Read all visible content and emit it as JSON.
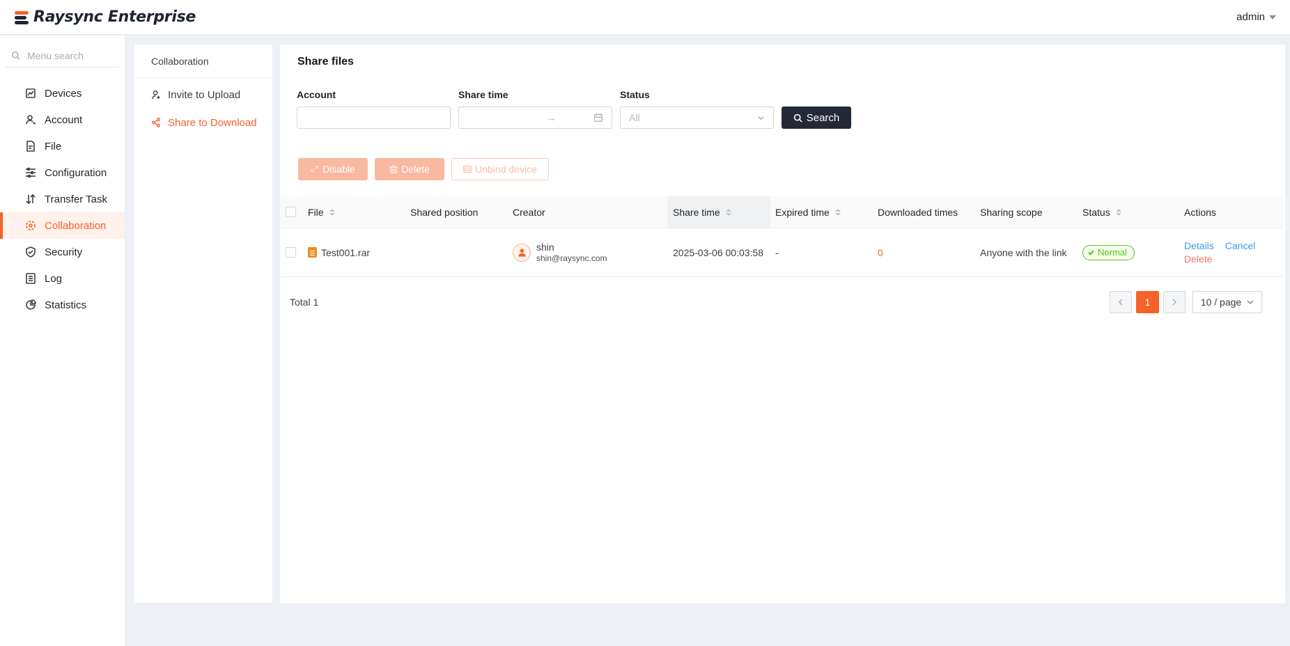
{
  "app": {
    "logo_text": "Raysync Enterprise",
    "user": "admin"
  },
  "sidebar": {
    "search_placeholder": "Menu search",
    "items": [
      {
        "label": "Devices",
        "icon": "devices-icon"
      },
      {
        "label": "Account",
        "icon": "user-icon"
      },
      {
        "label": "File",
        "icon": "file-icon"
      },
      {
        "label": "Configuration",
        "icon": "sliders-icon"
      },
      {
        "label": "Transfer Task",
        "icon": "transfer-icon"
      },
      {
        "label": "Collaboration",
        "icon": "collaboration-icon",
        "active": true
      },
      {
        "label": "Security",
        "icon": "shield-icon"
      },
      {
        "label": "Log",
        "icon": "log-icon"
      },
      {
        "label": "Statistics",
        "icon": "pie-chart-icon"
      }
    ]
  },
  "subnav": {
    "title": "Collaboration",
    "items": [
      {
        "label": "Invite to Upload",
        "icon": "invite-user-icon"
      },
      {
        "label": "Share to Download",
        "icon": "share-icon",
        "active": true
      }
    ]
  },
  "main": {
    "title": "Share files",
    "filters": {
      "account_label": "Account",
      "share_time_label": "Share time",
      "date_separator": "→",
      "status_label": "Status",
      "status_value": "All",
      "search_button": "Search"
    },
    "actions": {
      "disable": "Disable",
      "delete": "Delete",
      "unbind": "Unbind device"
    },
    "table": {
      "columns": [
        "File",
        "Shared position",
        "Creator",
        "Share time",
        "Expired time",
        "Downloaded times",
        "Sharing scope",
        "Status",
        "Actions"
      ],
      "rows": [
        {
          "file": "Test001.rar",
          "shared_position": "",
          "creator_name": "shin",
          "creator_email": "shin@raysync.com",
          "share_time": "2025-03-06 00:03:58",
          "expired_time": "-",
          "downloaded_times": "0",
          "sharing_scope": "Anyone with the link",
          "status": "Normal",
          "action_details": "Details",
          "action_cancel": "Cancel",
          "action_delete": "Delete"
        }
      ]
    },
    "pagination": {
      "total": "Total 1",
      "current_page": "1",
      "page_size": "10 / page"
    }
  },
  "colors": {
    "accent": "#f5622a",
    "dark_button": "#232937",
    "success": "#52c41a",
    "link": "#3b9be8"
  }
}
